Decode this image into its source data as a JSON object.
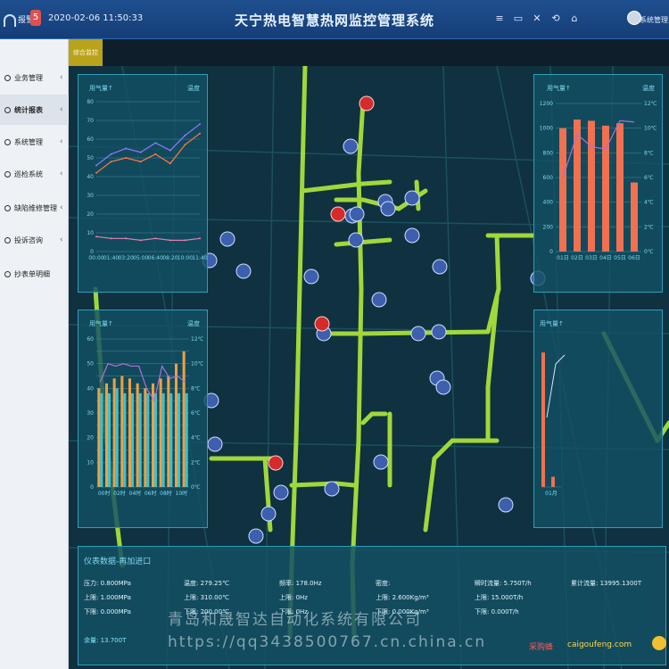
{
  "header": {
    "alarm_label": "报警",
    "alarm_count": "5",
    "datetime": "2020-02-06 11:50:33",
    "title": "天宁热电智慧热网监控管理系统",
    "user_name": "系统管理员"
  },
  "breadcrumb": {
    "label": "综合监控"
  },
  "sidebar": {
    "items": [
      {
        "label": "业务管理",
        "active": false
      },
      {
        "label": "统计报表",
        "active": true
      },
      {
        "label": "系统管理",
        "active": false
      },
      {
        "label": "巡检系统",
        "active": false
      },
      {
        "label": "缺陷维修管理",
        "active": false
      },
      {
        "label": "投诉咨询",
        "active": false
      },
      {
        "label": "抄表单明细",
        "active": false
      }
    ]
  },
  "panels": {
    "tl": {
      "title": "用气量↑",
      "legend": "温度"
    },
    "tr": {
      "title": "用气量↑",
      "legend": "温度"
    },
    "ml": {
      "title": "用气量↑",
      "legend": "温度"
    },
    "mr": {
      "title": "用气量↑",
      "legend": "温度"
    }
  },
  "chart_data": [
    {
      "type": "line",
      "x": [
        "00:00",
        "01:40",
        "03:20",
        "05:00",
        "06:40",
        "08:20",
        "10:00",
        "11:40"
      ],
      "ylim": [
        0,
        80
      ],
      "yticks": [
        0,
        10,
        20,
        30,
        40,
        50,
        60,
        70,
        80
      ],
      "series": [
        {
          "values": [
            46,
            52,
            55,
            53,
            58,
            54,
            62,
            68
          ],
          "color": "#8a7cff"
        },
        {
          "values": [
            42,
            48,
            50,
            48,
            52,
            47,
            57,
            63
          ],
          "color": "#ff7a3a"
        },
        {
          "values": [
            8,
            7,
            7,
            6,
            7,
            6,
            6,
            7
          ],
          "color": "#e080b0"
        }
      ]
    },
    {
      "type": "bar",
      "categories": [
        "01日",
        "02日",
        "03日",
        "04日",
        "05日",
        "06日"
      ],
      "ylim": [
        0,
        1200
      ],
      "yticks": [
        0,
        200,
        400,
        600,
        800,
        1000,
        1200
      ],
      "y2ticks": [
        "0℃",
        "2℃",
        "4℃",
        "6℃",
        "8℃",
        "10℃",
        "12℃"
      ],
      "values": [
        1000,
        1070,
        1060,
        1020,
        1040,
        560
      ],
      "line": [
        6,
        9.5,
        8.5,
        8.3,
        10.6,
        10.5
      ],
      "bar_color": "#f07050",
      "line_color": "#b070d0"
    },
    {
      "type": "bar",
      "categories": [
        "00时",
        "02时",
        "04时",
        "06时",
        "08时",
        "10时"
      ],
      "ylim": [
        0,
        60
      ],
      "yticks": [
        0,
        5,
        10,
        15,
        20,
        25,
        30,
        35,
        40,
        45,
        50,
        55,
        60
      ],
      "y2ticks": [
        "0℃",
        "2℃",
        "4℃",
        "6℃",
        "8℃",
        "10℃",
        "12℃"
      ],
      "series": [
        {
          "values": [
            40,
            42,
            44,
            45,
            44,
            42,
            40,
            42,
            44,
            45,
            50,
            55
          ],
          "color": "#f0a040"
        },
        {
          "values": [
            38,
            38,
            40,
            38,
            38,
            38,
            38,
            38,
            38,
            38,
            38,
            38
          ],
          "color": "#3fc0d0"
        }
      ],
      "line": [
        8.5,
        10,
        9.8,
        10,
        9.8,
        9.8,
        8,
        7,
        9.8,
        8.8,
        9,
        8.5
      ],
      "line_color": "#b070d0"
    },
    {
      "type": "bar",
      "categories": [
        "01月"
      ],
      "values": [
        1050,
        80
      ],
      "bar_color": "#f07050"
    }
  ],
  "data_panel": {
    "title": "仪表数据-再加进口",
    "rows": [
      [
        "压力: 0.800MPa",
        "温度: 279.25℃",
        "频率: 178.0Hz",
        "密度: ",
        "瞬时流量: 5.750T/h",
        "累计流量: 13995.1300T"
      ],
      [
        "上限: 1.000MPa",
        "上限: 310.00℃",
        "上限: 0Hz",
        "上限: 2.600Kg/m³",
        "上限: 15.000T/h",
        ""
      ],
      [
        "下限: 0.000MPa",
        "下限: 200.00℃",
        "下限: 0Hz",
        "下限: 0.000Kg/m³",
        "下限: 0.000T/h",
        ""
      ],
      [
        "余量: 13.700T",
        "",
        "",
        "",
        "",
        ""
      ]
    ]
  },
  "watermarks": {
    "company": "青岛和晟智达自动化系统有限公司",
    "url": "https://qq3438500767.cn.china.cn",
    "brand": "采购蜂",
    "site": "caigoufeng.com"
  }
}
